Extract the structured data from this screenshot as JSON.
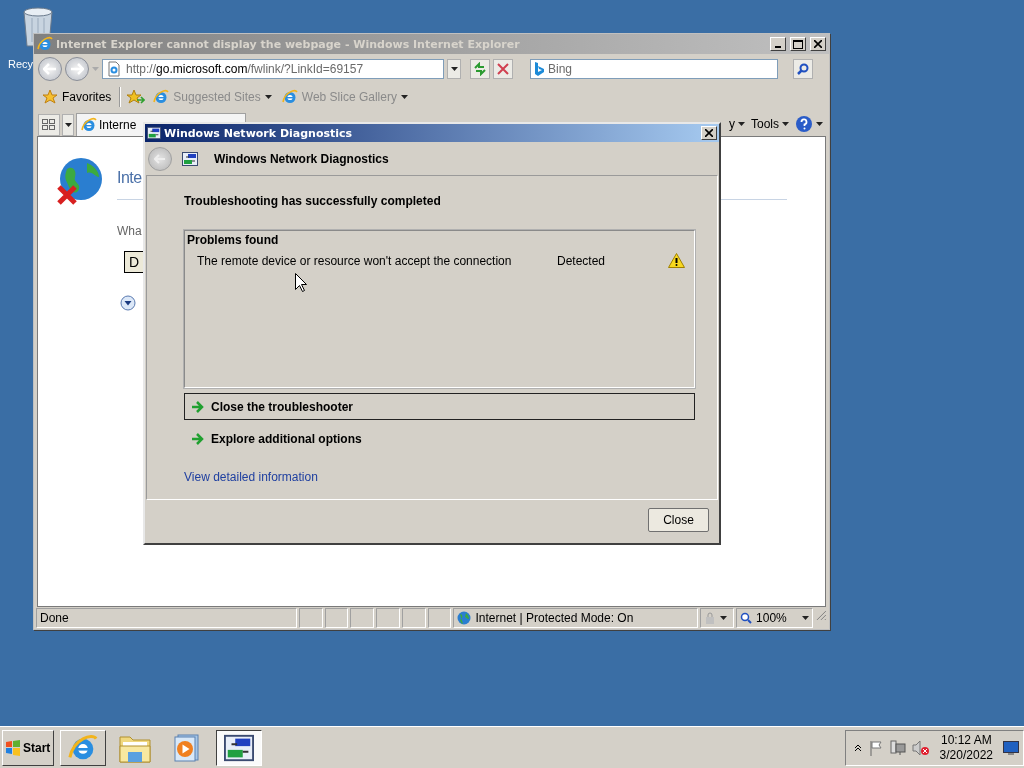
{
  "desktop": {
    "icons": [
      {
        "label": "Recy"
      }
    ]
  },
  "browser": {
    "title": "Internet Explorer cannot display the webpage - Windows Internet Explorer",
    "address": {
      "scheme": "http://",
      "host": "go.microsoft.com",
      "path": "/fwlink/?LinkId=69157"
    },
    "search": {
      "placeholder": "Bing"
    },
    "favorites_bar": [
      {
        "label": "Favorites",
        "disabled": false,
        "menu": false
      },
      {
        "label": "Suggested Sites",
        "disabled": true,
        "menu": true
      },
      {
        "label": "Web Slice Gallery",
        "disabled": true,
        "menu": true
      }
    ],
    "tab": {
      "label": "Interne"
    },
    "commands": [
      {
        "label": "y"
      },
      {
        "label": "Tools"
      }
    ],
    "page": {
      "heading": "Inte",
      "text": "Wha",
      "button": "D"
    },
    "status_bar": {
      "status": "Done",
      "zone": "Internet | Protected Mode: On",
      "zoom": "100%"
    }
  },
  "dialog": {
    "title": "Windows Network Diagnostics",
    "header": "Windows Network Diagnostics",
    "message": "Troubleshooting has successfully completed",
    "problems": {
      "title": "Problems found",
      "rows": [
        {
          "text": "The remote device or resource won't accept the connection",
          "status": "Detected"
        }
      ]
    },
    "command_links": [
      {
        "label": "Close the troubleshooter",
        "focused": true
      },
      {
        "label": "Explore additional options",
        "focused": false
      }
    ],
    "link": "View detailed information",
    "button": "Close"
  },
  "taskbar": {
    "start": "Start",
    "buttons": [
      {
        "kind": "ie",
        "running": true,
        "selected": false
      },
      {
        "kind": "folder",
        "running": false,
        "selected": false
      },
      {
        "kind": "media",
        "running": false,
        "selected": false
      },
      {
        "kind": "network",
        "running": true,
        "selected": true
      }
    ],
    "clock": {
      "time": "10:12 AM",
      "date": "3/20/2022"
    }
  }
}
